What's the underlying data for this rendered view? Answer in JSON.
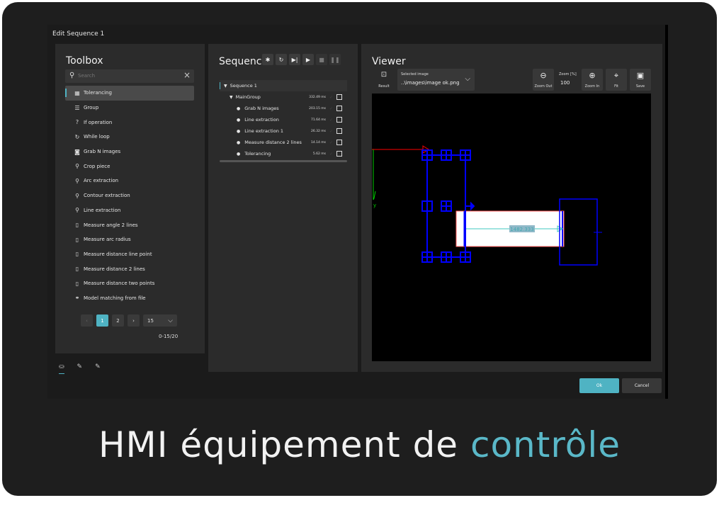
{
  "window": {
    "title": "Edit Sequence 1"
  },
  "toolbox": {
    "title": "Toolbox",
    "search_placeholder": "Search",
    "items": [
      {
        "label": "Tolerancing",
        "icon": "grid-icon",
        "glyph": "▦",
        "selected": true
      },
      {
        "label": "Group",
        "icon": "list-icon",
        "glyph": "☰"
      },
      {
        "label": "If operation",
        "icon": "question-icon",
        "glyph": "?"
      },
      {
        "label": "While loop",
        "icon": "refresh-icon",
        "glyph": "↻"
      },
      {
        "label": "Grab N images",
        "icon": "camera-icon",
        "glyph": "◙"
      },
      {
        "label": "Crop piece",
        "icon": "search-icon",
        "glyph": "⚲"
      },
      {
        "label": "Arc extraction",
        "icon": "search-icon",
        "glyph": "⚲"
      },
      {
        "label": "Contour extraction",
        "icon": "search-icon",
        "glyph": "⚲"
      },
      {
        "label": "Line extraction",
        "icon": "search-icon",
        "glyph": "⚲"
      },
      {
        "label": "Measure angle 2 lines",
        "icon": "ruler-icon",
        "glyph": "▯"
      },
      {
        "label": "Measure arc radius",
        "icon": "ruler-icon",
        "glyph": "▯"
      },
      {
        "label": "Measure distance line point",
        "icon": "ruler-icon",
        "glyph": "▯"
      },
      {
        "label": "Measure distance 2 lines",
        "icon": "ruler-icon",
        "glyph": "▯"
      },
      {
        "label": "Measure distance two points",
        "icon": "ruler-icon",
        "glyph": "▯"
      },
      {
        "label": "Model matching from file",
        "icon": "link-icon",
        "glyph": "⚭"
      }
    ],
    "pager": {
      "prev": "‹",
      "page1": "1",
      "page2": "2",
      "next": "›",
      "per_page": "15",
      "range": "0-15/20"
    },
    "tabs": [
      "⛀",
      "✎",
      "✎"
    ]
  },
  "sequence": {
    "title": "Sequence",
    "tools": [
      "✱",
      "↻",
      "▶|",
      "▶",
      "■",
      "❚❚"
    ],
    "tree": [
      {
        "label": "Sequence 1",
        "level": 0,
        "time": ""
      },
      {
        "label": "MainGroup",
        "level": 1,
        "time": "332.49 ms"
      },
      {
        "label": "Grab N images",
        "level": 2,
        "time": "203.15 ms"
      },
      {
        "label": "Line extraction",
        "level": 2,
        "time": "71.64 ms"
      },
      {
        "label": "Line extraction 1",
        "level": 2,
        "time": "26.32 ms"
      },
      {
        "label": "Measure distance 2 lines",
        "level": 2,
        "time": "14.14 ms"
      },
      {
        "label": "Tolerancing",
        "level": 2,
        "time": "5.62 ms"
      }
    ]
  },
  "viewer": {
    "title": "Viewer",
    "result_label": "Result",
    "selected_image_caption": "Selected image",
    "selected_image_value": "..\\images\\image ok.png",
    "zoom_out_label": "Zoom Out",
    "zoom_caption": "Zoom [%]",
    "zoom_value": "100",
    "zoom_in_label": "Zoom In",
    "fit_label": "Fit",
    "save_label": "Save",
    "measurement_label": "1482.333",
    "axis_y": "y"
  },
  "footer": {
    "ok_label": "Ok",
    "cancel_label": "Cancel"
  },
  "caption": {
    "main": "HMI équipement de ",
    "accent": "contrôle"
  },
  "colors": {
    "accent": "#4fb3c3",
    "overlay_blue": "#0000ff",
    "axis_red": "#ff0000",
    "axis_green": "#00cc00",
    "measure_cyan": "#40c8c0"
  }
}
